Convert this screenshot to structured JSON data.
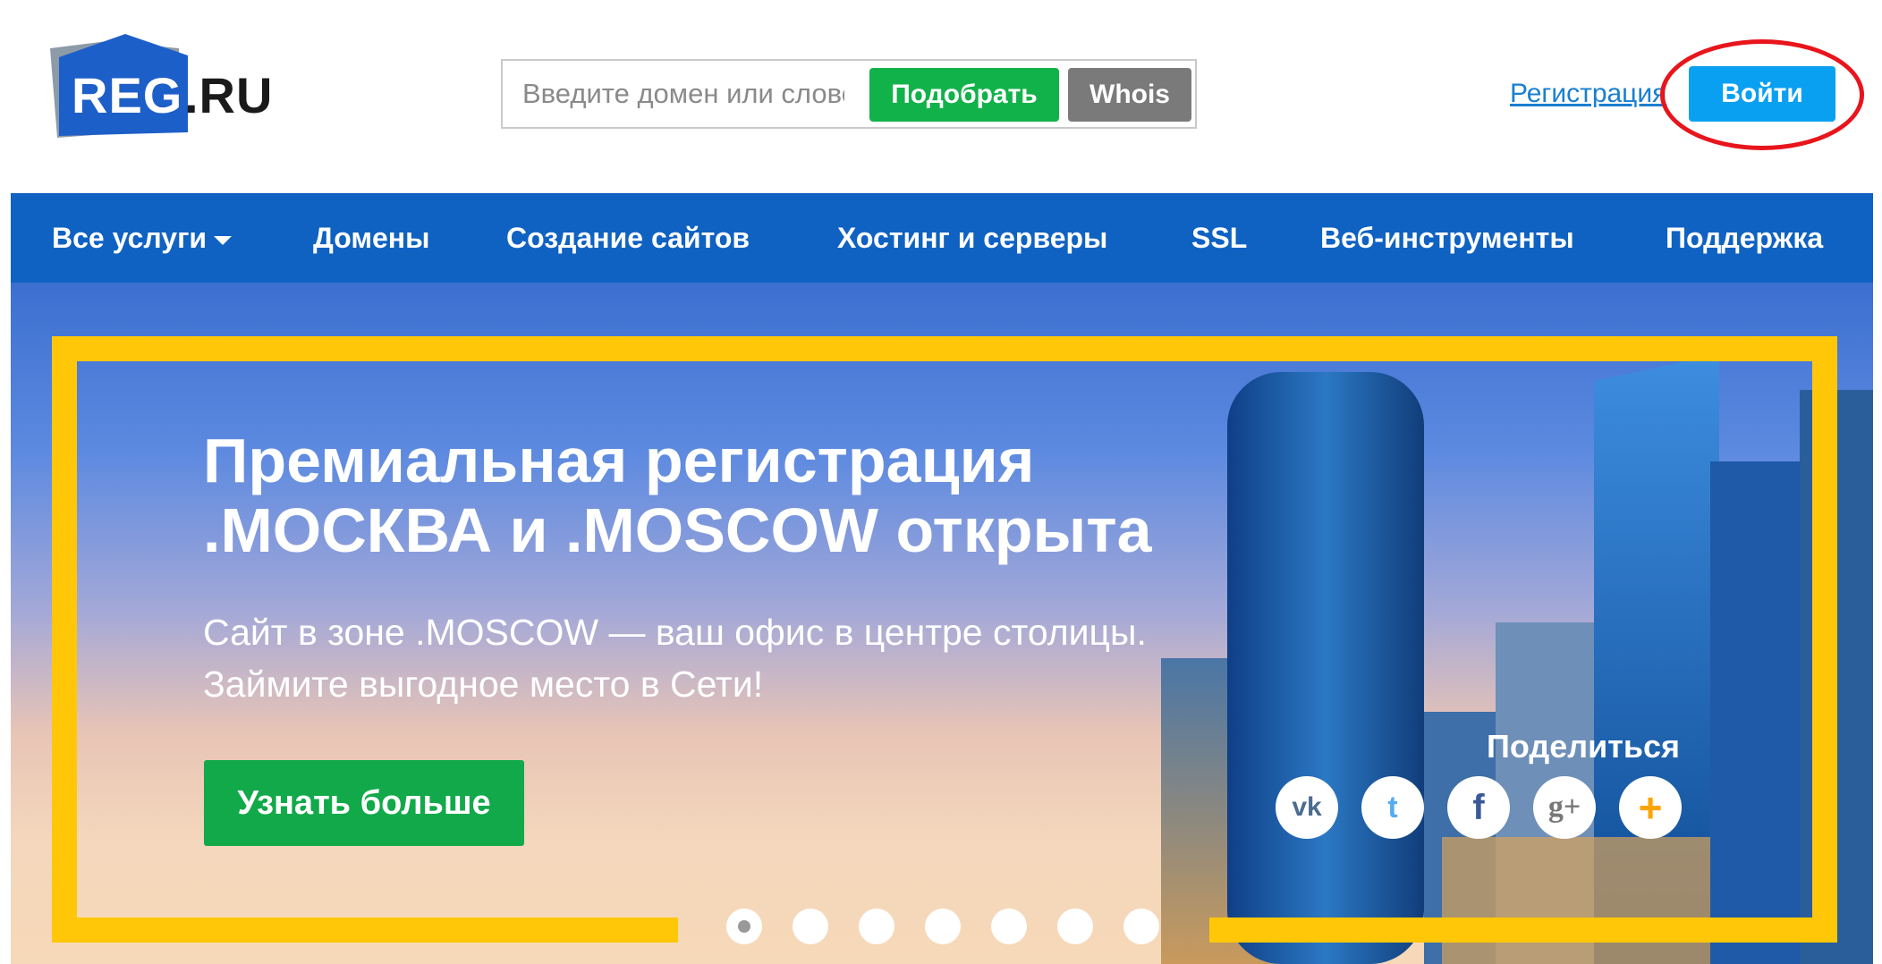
{
  "header": {
    "logo_reg": "REG",
    "logo_ru": ".RU",
    "search_placeholder": "Введите домен или слово",
    "pick_label": "Подобрать",
    "whois_label": "Whois",
    "register_label": "Регистрация",
    "login_label": "Войти"
  },
  "nav": {
    "items": [
      {
        "label": "Все услуги"
      },
      {
        "label": "Домены"
      },
      {
        "label": "Создание сайтов"
      },
      {
        "label": "Хостинг и серверы"
      },
      {
        "label": "SSL"
      },
      {
        "label": "Веб-инструменты"
      },
      {
        "label": "Поддержка"
      }
    ]
  },
  "hero": {
    "title_line1": "Премиальная регистрация",
    "title_line2": ".МОСКВА и .MOSCOW открыта",
    "subtitle_line1": "Сайт в зоне .MOSCOW — ваш офис в центре столицы.",
    "subtitle_line2": "Займите выгодное место в Сети!",
    "cta_label": "Узнать больше",
    "share_label": "Поделиться",
    "social": [
      {
        "icon": "vk-icon",
        "glyph": "vk"
      },
      {
        "icon": "twitter-icon",
        "glyph": "t"
      },
      {
        "icon": "facebook-icon",
        "glyph": "f"
      },
      {
        "icon": "google-plus-icon",
        "glyph": "g+"
      },
      {
        "icon": "more-share-icon",
        "glyph": "+"
      }
    ],
    "slider_active": 1
  },
  "colors": {
    "brand_blue": "#0f62c2",
    "green": "#12b24a",
    "login_blue": "#0aa0f2",
    "frame_yellow": "#ffc707",
    "highlight_red": "#e8151c"
  }
}
